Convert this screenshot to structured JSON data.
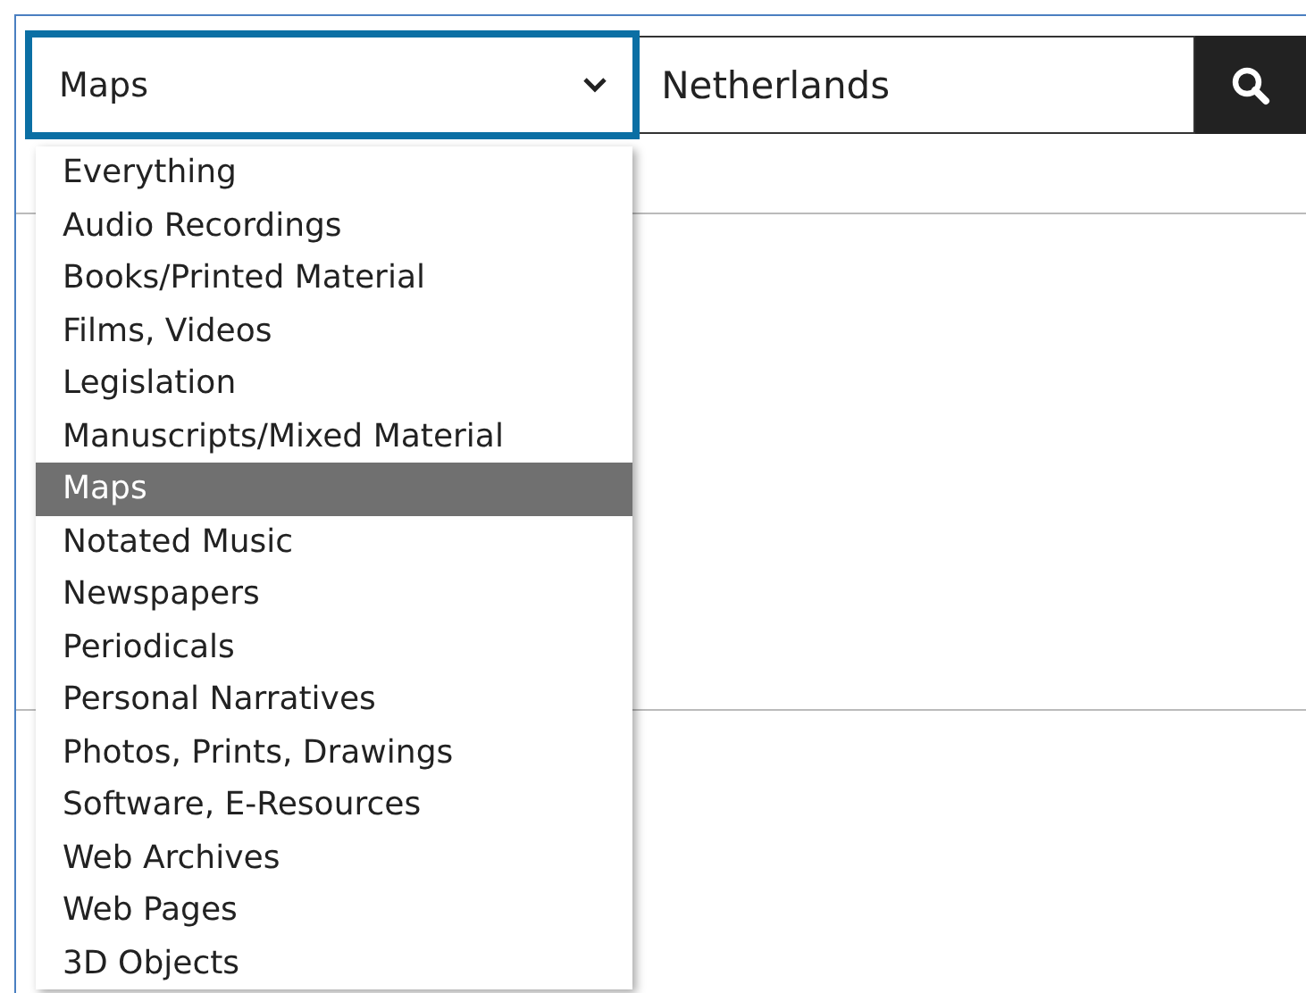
{
  "search": {
    "scope_select": {
      "value": "Maps"
    },
    "query_field": {
      "value": "Netherlands"
    }
  },
  "dropdown": {
    "options": [
      {
        "label": "Everything",
        "selected": false
      },
      {
        "label": "Audio Recordings",
        "selected": false
      },
      {
        "label": "Books/Printed Material",
        "selected": false
      },
      {
        "label": "Films, Videos",
        "selected": false
      },
      {
        "label": "Legislation",
        "selected": false
      },
      {
        "label": "Manuscripts/Mixed Material",
        "selected": false
      },
      {
        "label": "Maps",
        "selected": true
      },
      {
        "label": "Notated Music",
        "selected": false
      },
      {
        "label": "Newspapers",
        "selected": false
      },
      {
        "label": "Periodicals",
        "selected": false
      },
      {
        "label": "Personal Narratives",
        "selected": false
      },
      {
        "label": "Photos, Prints, Drawings",
        "selected": false
      },
      {
        "label": "Software, E-Resources",
        "selected": false
      },
      {
        "label": "Web Archives",
        "selected": false
      },
      {
        "label": "Web Pages",
        "selected": false
      },
      {
        "label": "3D Objects",
        "selected": false
      }
    ]
  }
}
